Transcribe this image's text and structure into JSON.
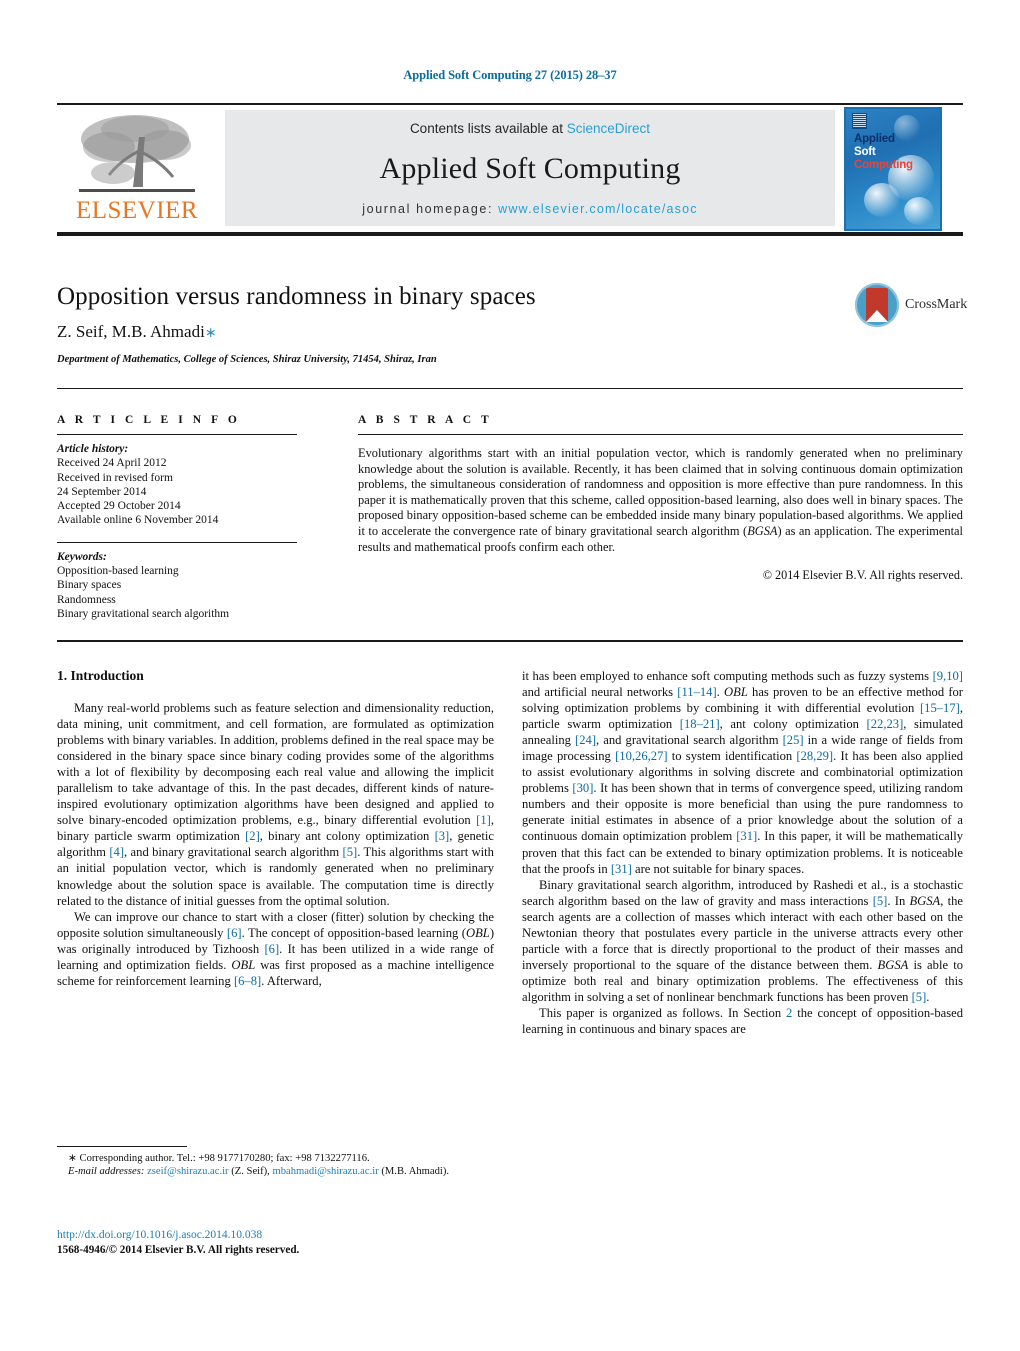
{
  "running_head": "Applied Soft Computing 27 (2015) 28–37",
  "masthead": {
    "publisher_name": "ELSEVIER",
    "contents_prefix": "Contents lists available at ",
    "contents_link": "ScienceDirect",
    "journal_title": "Applied Soft Computing",
    "homepage_prefix": "journal homepage: ",
    "homepage_url": "www.elsevier.com/locate/asoc",
    "cover": {
      "line1": "Applied",
      "line2": "Soft",
      "line3": "Computing"
    }
  },
  "article": {
    "title": "Opposition versus randomness in binary spaces",
    "authors": "Z. Seif, M.B. Ahmadi",
    "corresponding_marker": "∗",
    "affiliation": "Department of Mathematics, College of Sciences, Shiraz University, 71454, Shiraz, Iran",
    "crossmark_label": "CrossMark"
  },
  "article_info": {
    "heading": "A R T I C L E    I N F O",
    "history_label": "Article history:",
    "history": [
      "Received 24 April 2012",
      "Received in revised form",
      "24 September 2014",
      "Accepted 29 October 2014",
      "Available online 6 November 2014"
    ],
    "keywords_label": "Keywords:",
    "keywords": [
      "Opposition-based learning",
      "Binary spaces",
      "Randomness",
      "Binary gravitational search algorithm"
    ]
  },
  "abstract": {
    "heading": "A B S T R A C T",
    "text": "Evolutionary algorithms start with an initial population vector, which is randomly generated when no preliminary knowledge about the solution is available. Recently, it has been claimed that in solving continuous domain optimization problems, the simultaneous consideration of randomness and opposition is more effective than pure randomness. In this paper it is mathematically proven that this scheme, called opposition-based learning, also does well in binary spaces. The proposed binary opposition-based scheme can be embedded inside many binary population-based algorithms. We applied it to accelerate the convergence rate of binary gravitational search algorithm (BGSA) as an application. The experimental results and mathematical proofs confirm each other.",
    "copyright": "© 2014 Elsevier B.V. All rights reserved."
  },
  "body": {
    "section_number_title": "1.  Introduction",
    "left_paragraphs": [
      "Many real-world problems such as feature selection and dimensionality reduction, data mining, unit commitment, and cell formation, are formulated as optimization problems with binary variables. In addition, problems defined in the real space may be considered in the binary space since binary coding provides some of the algorithms with a lot of flexibility by decomposing each real value and allowing the implicit parallelism to take advantage of this. In the past decades, different kinds of nature-inspired evolutionary optimization algorithms have been designed and applied to solve binary-encoded optimization problems, e.g., binary differential evolution [1], binary particle swarm optimization [2], binary ant colony optimization [3], genetic algorithm [4], and binary gravitational search algorithm [5]. This algorithms start with an initial population vector, which is randomly generated when no preliminary knowledge about the solution space is available. The computation time is directly related to the distance of initial guesses from the optimal solution.",
      "We can improve our chance to start with a closer (fitter) solution by checking the opposite solution simultaneously [6]. The concept of opposition-based learning (OBL) was originally introduced by Tizhoosh [6]. It has been utilized in a wide range of learning and optimization fields. OBL was first proposed as a machine intelligence scheme for reinforcement learning [6–8]. Afterward,"
    ],
    "right_paragraphs": [
      "it has been employed to enhance soft computing methods such as fuzzy systems [9,10] and artificial neural networks [11–14]. OBL has proven to be an effective method for solving optimization problems by combining it with differential evolution [15–17], particle swarm optimization [18–21], ant colony optimization [22,23], simulated annealing [24], and gravitational search algorithm [25] in a wide range of fields from image processing [10,26,27] to system identification [28,29]. It has been also applied to assist evolutionary algorithms in solving discrete and combinatorial optimization problems [30]. It has been shown that in terms of convergence speed, utilizing random numbers and their opposite is more beneficial than using the pure randomness to generate initial estimates in absence of a prior knowledge about the solution of a continuous domain optimization problem [31]. In this paper, it will be mathematically proven that this fact can be extended to binary optimization problems. It is noticeable that the proofs in [31] are not suitable for binary spaces.",
      "Binary gravitational search algorithm, introduced by Rashedi et al., is a stochastic search algorithm based on the law of gravity and mass interactions [5]. In BGSA, the search agents are a collection of masses which interact with each other based on the Newtonian theory that postulates every particle in the universe attracts every other particle with a force that is directly proportional to the product of their masses and inversely proportional to the square of the distance between them. BGSA is able to optimize both real and binary optimization problems. The effectiveness of this algorithm in solving a set of nonlinear benchmark functions has been proven [5].",
      "This paper is organized as follows. In Section 2 the concept of opposition-based learning in continuous and binary spaces are"
    ]
  },
  "footnotes": {
    "corresponding": "∗ Corresponding author. Tel.: +98 9177170280; fax: +98 7132277116.",
    "email_label": "E-mail addresses:",
    "email1": "zseif@shirazu.ac.ir",
    "email1_owner": "(Z. Seif),",
    "email2": "mbahmadi@shirazu.ac.ir",
    "email2_owner": "(M.B. Ahmadi).",
    "doi_url": "http://dx.doi.org/10.1016/j.asoc.2014.10.038",
    "issn_line": "1568-4946/© 2014 Elsevier B.V. All rights reserved."
  },
  "colors": {
    "link_blue": "#0b6d9e",
    "sciencedirect_blue": "#2a9fd0",
    "elsevier_orange": "#e87722",
    "cover_blue": "#1f6fb2"
  }
}
